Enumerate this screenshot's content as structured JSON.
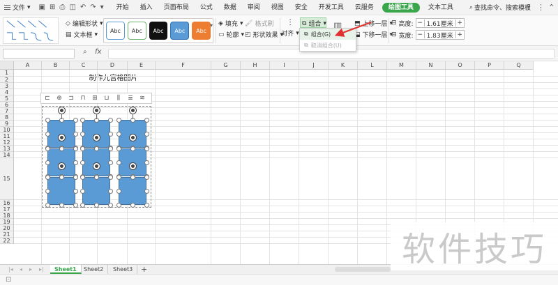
{
  "menubar": {
    "file_label": "文件",
    "tabs": [
      "开始",
      "插入",
      "页面布局",
      "公式",
      "数据",
      "审阅",
      "视图",
      "安全",
      "开发工具",
      "云服务",
      "绘图工具",
      "文本工具"
    ],
    "active_tab": "绘图工具",
    "search_label": "查找命令、搜索模板"
  },
  "ribbon": {
    "edit_shape": "编辑形状",
    "text_box": "文本框",
    "style_label": "Abc",
    "fill": "填充",
    "outline": "轮廓",
    "format_painter": "格式刷",
    "shape_effects": "形状效果",
    "align": "对齐",
    "group": "组合",
    "bring_forward": "上移一层",
    "send_backward": "下移一层",
    "height_label": "高度:",
    "height_value": "1.61厘米",
    "width_label": "宽度:",
    "width_value": "1.83厘米",
    "minus": "−",
    "plus": "+"
  },
  "dropdown": {
    "items": [
      {
        "label": "组合(G)",
        "enabled": true
      },
      {
        "label": "取消组合(U)",
        "enabled": false
      }
    ]
  },
  "formula": {
    "fx": "fx"
  },
  "grid": {
    "columns": [
      "A",
      "B",
      "C",
      "D",
      "E",
      "F",
      "G",
      "H",
      "I",
      "J",
      "K",
      "L",
      "M",
      "N",
      "O",
      "P",
      "Q"
    ],
    "rows": [
      "1",
      "2",
      "3",
      "4",
      "5",
      "6",
      "7",
      "8",
      "9",
      "10",
      "11",
      "12",
      "13",
      "14",
      "15",
      "16",
      "17",
      "18",
      "19",
      "20",
      "21",
      "22"
    ],
    "title_cell": "制作九宫格图片"
  },
  "sheets": [
    "Sheet1",
    "Sheet2",
    "Sheet3"
  ],
  "add_sheet": "+",
  "watermark": "软件技巧",
  "colors": {
    "accent": "#3aa64b",
    "shape_fill": "#5b9bd5",
    "shape_border": "#41719c",
    "arrow": "#e03030"
  }
}
